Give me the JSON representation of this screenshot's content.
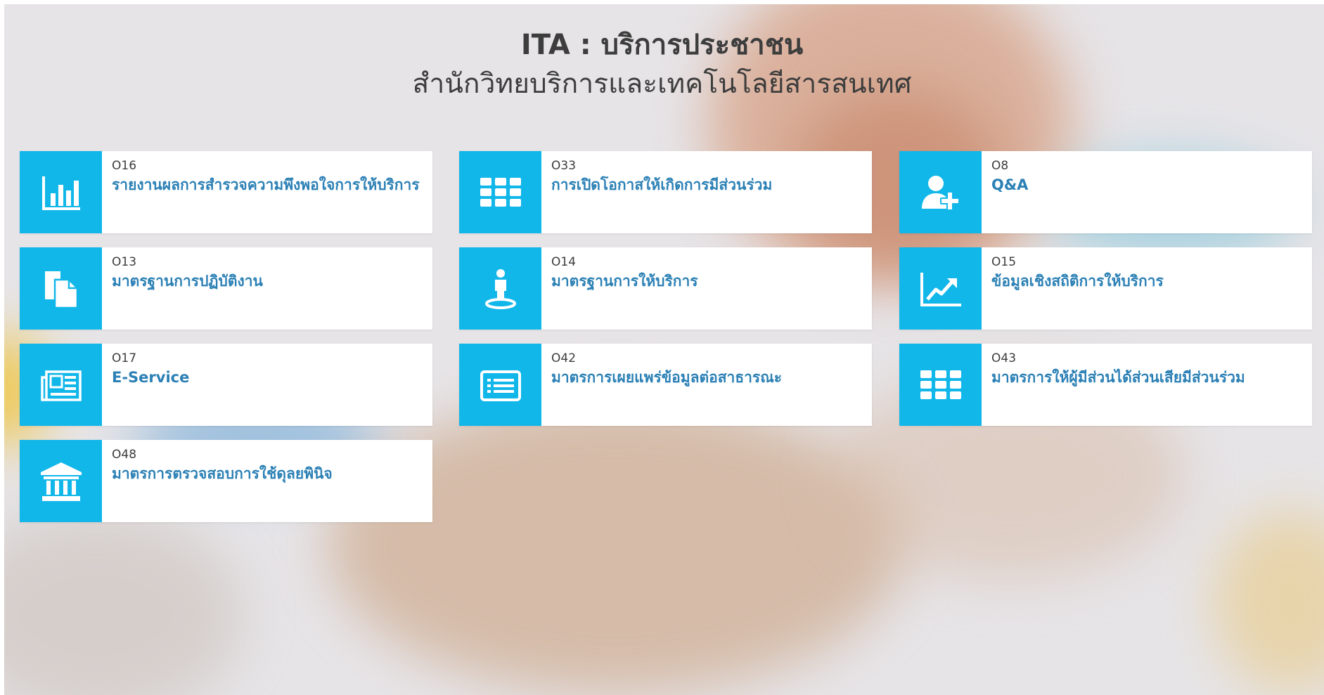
{
  "header": {
    "title": "ITA : บริการประชาชน",
    "subtitle": "สำนักวิทยบริการและเทคโนโลยีสารสนเทศ"
  },
  "tiles": [
    {
      "code": "O16",
      "label": "รายงานผลการสำรวจความพึงพอใจการให้บริการ",
      "icon": "bar-chart-icon"
    },
    {
      "code": "O33",
      "label": "การเปิดโอกาสให้เกิดการมีส่วนร่วม",
      "icon": "grid-icon"
    },
    {
      "code": "O8",
      "label": "Q&A",
      "icon": "user-plus-icon"
    },
    {
      "code": "O13",
      "label": "มาตรฐานการปฏิบัติงาน",
      "icon": "documents-icon"
    },
    {
      "code": "O14",
      "label": "มาตรฐานการให้บริการ",
      "icon": "person-pin-icon"
    },
    {
      "code": "O15",
      "label": "ข้อมูลเชิงสถิติการให้บริการ",
      "icon": "line-chart-icon"
    },
    {
      "code": "O17",
      "label": "E-Service",
      "icon": "newspaper-icon"
    },
    {
      "code": "O42",
      "label": "มาตรการเผยแพร่ข้อมูลต่อสาธารณะ",
      "icon": "list-icon"
    },
    {
      "code": "O43",
      "label": "มาตรการให้ผู้มีส่วนได้ส่วนเสียมีส่วนร่วม",
      "icon": "grid-icon"
    },
    {
      "code": "O48",
      "label": "มาตรการตรวจสอบการใช้ดุลยพินิจ",
      "icon": "bank-icon"
    }
  ],
  "colors": {
    "accent": "#12b7ea",
    "link": "#2b80b5",
    "heading": "#3d3d3d"
  }
}
